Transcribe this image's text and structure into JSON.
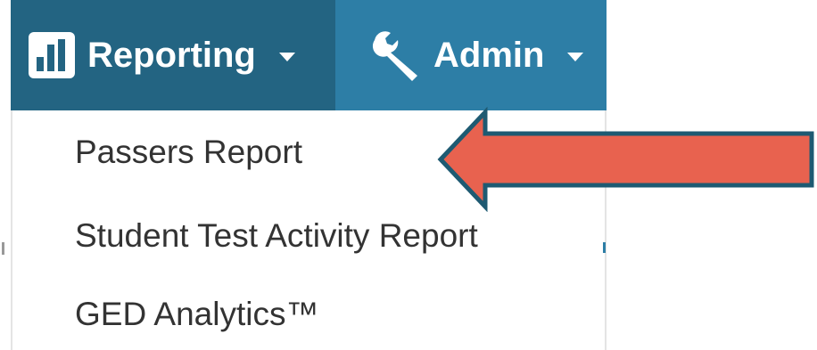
{
  "navbar": {
    "reporting_label": "Reporting",
    "admin_label": "Admin",
    "reporting_icon": "bar-chart-icon",
    "admin_icon": "wrench-icon",
    "colors": {
      "bar": "#2d7ea6",
      "active": "#236482"
    }
  },
  "dropdown": {
    "items": [
      {
        "label": "Passers Report"
      },
      {
        "label": "Student Test Activity Report"
      },
      {
        "label": "GED Analytics™"
      }
    ]
  },
  "annotation": {
    "arrow_color": "#e8624f",
    "arrow_outline": "#1e5a72",
    "points_to": "Passers Report"
  }
}
